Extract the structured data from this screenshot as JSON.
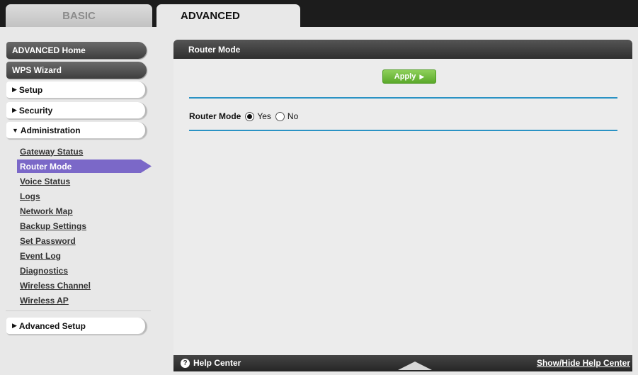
{
  "tabs": {
    "basic": "BASIC",
    "advanced": "ADVANCED"
  },
  "sidebar": {
    "advanced_home": "ADVANCED Home",
    "wps_wizard": "WPS Wizard",
    "setup": "Setup",
    "security": "Security",
    "administration": "Administration",
    "admin_items": [
      "Gateway Status",
      "Router Mode",
      "Voice Status",
      "Logs",
      "Network Map",
      "Backup Settings",
      "Set Password",
      "Event Log",
      "Diagnostics",
      "Wireless Channel",
      "Wireless AP"
    ],
    "active_item": "Router Mode",
    "advanced_setup": "Advanced Setup"
  },
  "panel": {
    "title": "Router Mode",
    "apply_label": "Apply",
    "field_label": "Router Mode",
    "option_yes": "Yes",
    "option_no": "No",
    "selected": "Yes"
  },
  "footer": {
    "help_title": "Help Center",
    "toggle_label": "Show/Hide Help Center"
  },
  "colors": {
    "accent_blue": "#2a92c4",
    "active_purple": "#7b68c8",
    "apply_green": "#5ba92a"
  }
}
